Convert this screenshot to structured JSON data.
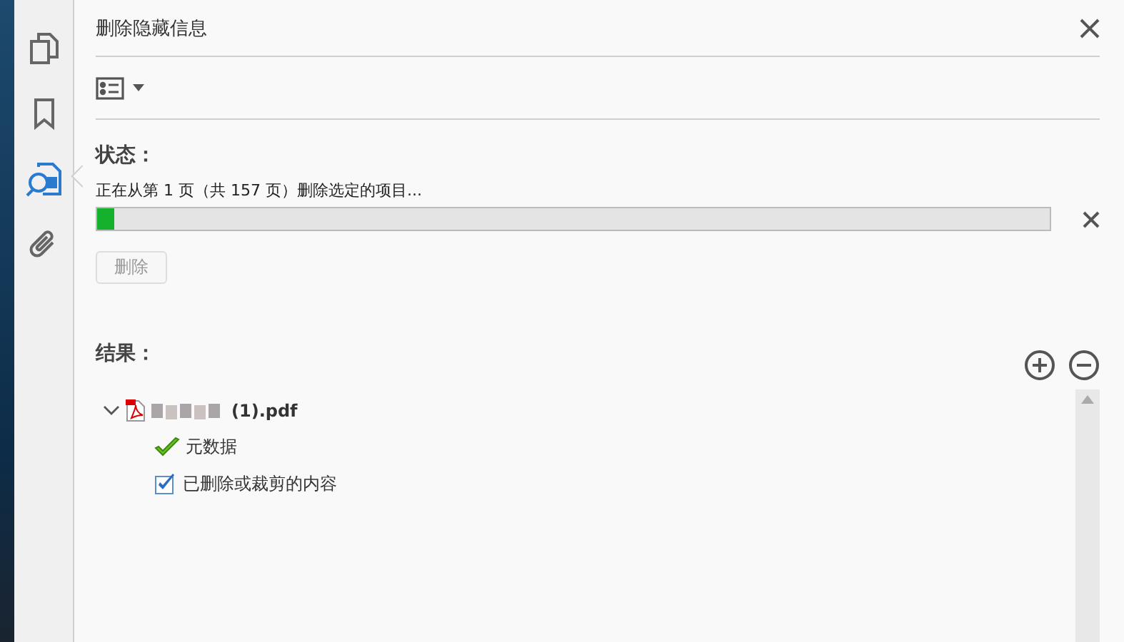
{
  "sidebar": {
    "items": [
      {
        "kind": "pages",
        "selected": false
      },
      {
        "kind": "bookmark",
        "selected": false
      },
      {
        "kind": "redact",
        "selected": true
      },
      {
        "kind": "attachment",
        "selected": false
      }
    ]
  },
  "panel": {
    "title": "删除隐藏信息"
  },
  "status": {
    "label": "状态：",
    "message": "正在从第 1 页（共 157 页）删除选定的项目...",
    "level": 0.018,
    "button": {
      "label": "删除",
      "disabled": true
    }
  },
  "results": {
    "label": "结果：",
    "tree": [
      {
        "name": "(1).pdf",
        "expanded": true,
        "children": [
          {
            "name": "元数据",
            "kind": "done"
          },
          {
            "name": "已删除或裁剪的内容",
            "kind": "checkbox",
            "checked": true
          }
        ]
      }
    ]
  }
}
